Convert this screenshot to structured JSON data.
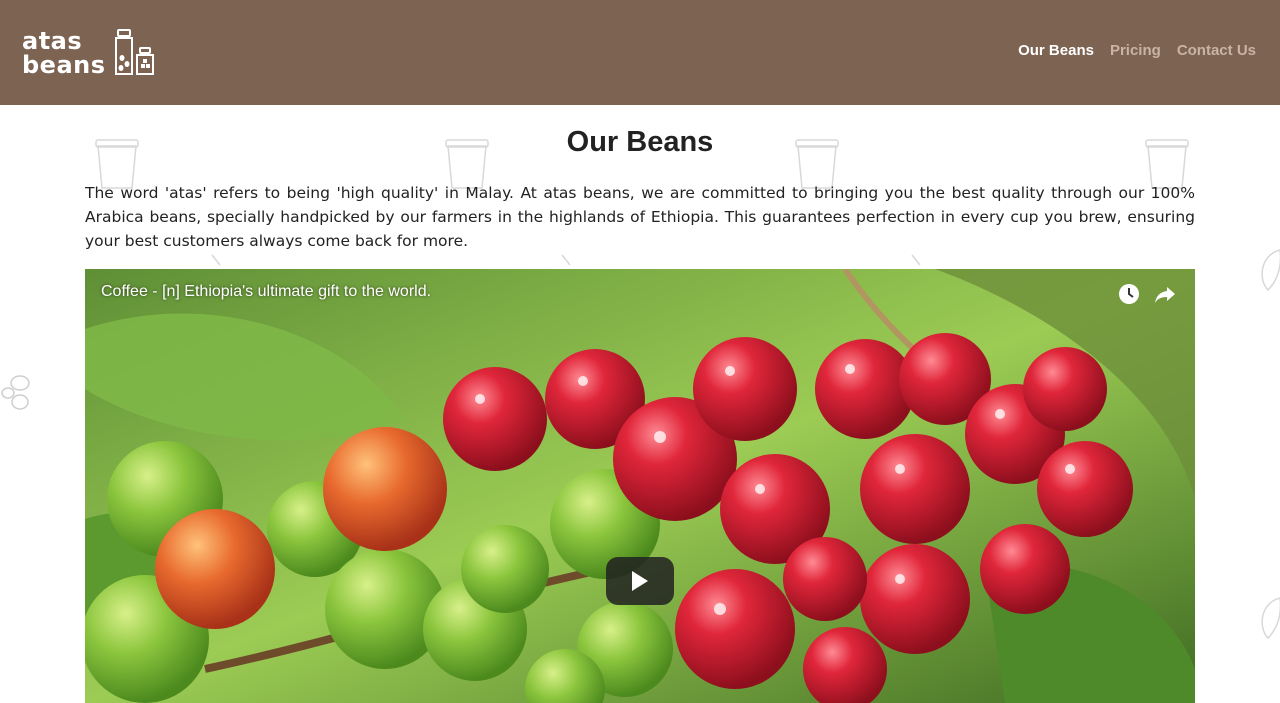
{
  "brand": {
    "line1": "atas",
    "line2": "beans"
  },
  "nav": {
    "items": [
      {
        "label": "Our Beans",
        "active": true
      },
      {
        "label": "Pricing",
        "active": false
      },
      {
        "label": "Contact Us",
        "active": false
      }
    ]
  },
  "main": {
    "title": "Our Beans",
    "intro": "The word 'atas' refers to being 'high quality' in Malay. At atas beans, we are committed to bringing you the best quality through our 100% Arabica beans, specially handpicked by our farmers in the highlands of Ethiopia. This guarantees perfection in every cup you brew, ensuring your best customers always come back for more."
  },
  "video": {
    "title": "Coffee - [n] Ethiopia's ultimate gift to the world.",
    "icons": [
      "clock-icon",
      "share-icon",
      "play-icon"
    ]
  },
  "colors": {
    "header_bg": "#7d6352",
    "nav_active": "#ffffff",
    "nav_inactive": "#c9b3a4",
    "text": "#222222"
  }
}
